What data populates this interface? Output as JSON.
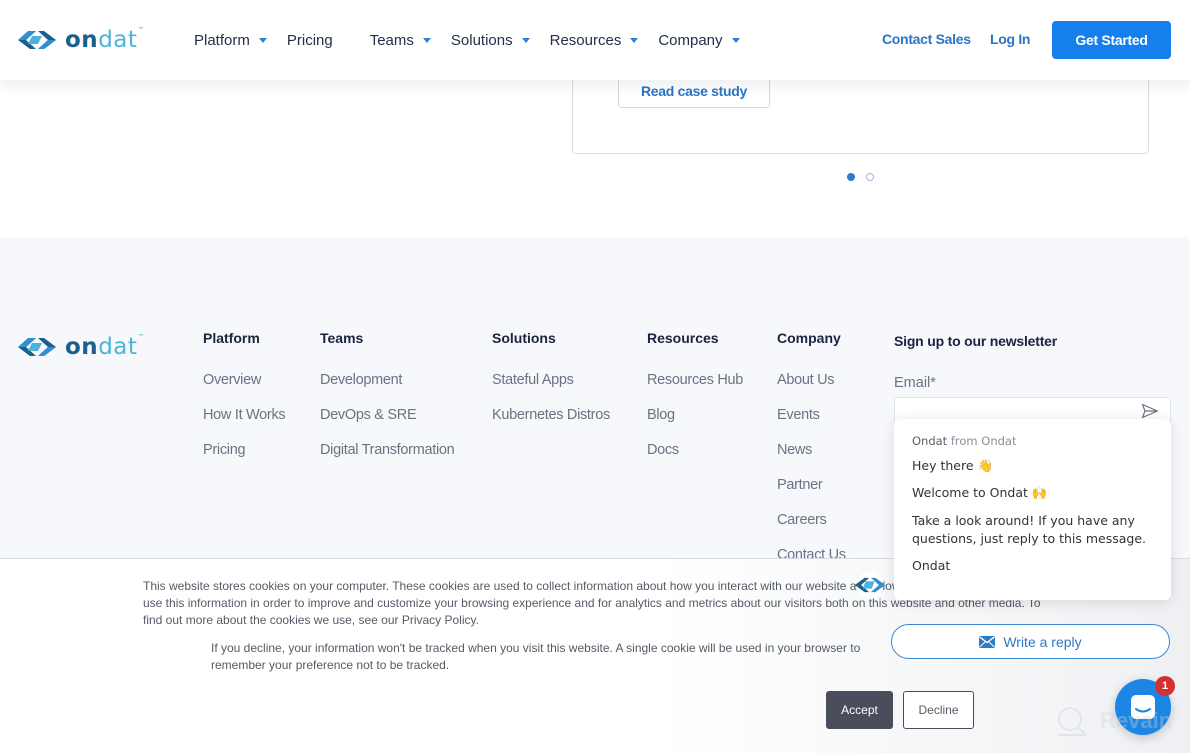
{
  "brand": {
    "name_bold": "on",
    "name_light": "dat",
    "tm": "™",
    "primary": "#1580ec",
    "link": "#2a75c4"
  },
  "header": {
    "nav": [
      {
        "label": "Platform",
        "dropdown": true
      },
      {
        "label": "Pricing",
        "dropdown": false
      },
      {
        "label": "Teams",
        "dropdown": true
      },
      {
        "label": "Solutions",
        "dropdown": true
      },
      {
        "label": "Resources",
        "dropdown": true
      },
      {
        "label": "Company",
        "dropdown": true
      }
    ],
    "contact_sales": "Contact Sales",
    "log_in": "Log In",
    "get_started": "Get Started"
  },
  "case_study": {
    "button_label": "Read case study",
    "carousel": {
      "total": 2,
      "active": 1
    }
  },
  "footer": {
    "columns": [
      {
        "title": "Platform",
        "links": [
          "Overview",
          "How It Works",
          "Pricing"
        ]
      },
      {
        "title": "Teams",
        "links": [
          "Development",
          "DevOps & SRE",
          "Digital Transformation"
        ]
      },
      {
        "title": "Solutions",
        "links": [
          "Stateful Apps",
          "Kubernetes Distros"
        ]
      },
      {
        "title": "Resources",
        "links": [
          "Resources Hub",
          "Blog",
          "Docs"
        ]
      },
      {
        "title": "Company",
        "links": [
          "About Us",
          "Events",
          "News",
          "Partner",
          "Careers",
          "Contact Us"
        ]
      }
    ],
    "newsletter": {
      "title": "Sign up to our newsletter",
      "email_label": "Email*",
      "email_value": "",
      "send_icon": "send-icon"
    }
  },
  "cookie_banner": {
    "text1": "This website stores cookies on your computer. These cookies are used to collect information about how you interact with our website and allow us to remember you. We use this information in order to improve and customize your browsing experience and for analytics and metrics about our visitors both on this website and other media. To find out more about the cookies we use, see our Privacy Policy.",
    "text2": "If you decline, your information won't be tracked when you visit this website. A single cookie will be used in your browser to remember your preference not to be tracked.",
    "accept": "Accept",
    "decline": "Decline"
  },
  "chat": {
    "sender_name": "Ondat",
    "sender_suffix": "from Ondat",
    "messages": [
      "Hey there 👋",
      "Welcome to Ondat 🙌",
      "Take a look around! If you have any questions, just reply to this message.",
      "Ondat"
    ],
    "reply_label": "Write a reply",
    "unread_count": "1"
  },
  "watermark": "Revain"
}
